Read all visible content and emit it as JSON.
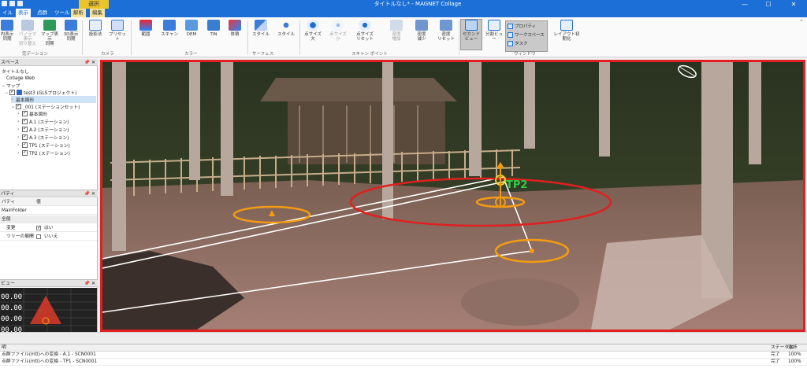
{
  "titlebar": {
    "context_tab": "選択",
    "title": "タイトルなし* - MAGNET Collage",
    "minimize": "—",
    "maximize": "☐",
    "close": "✕"
  },
  "tabs": [
    {
      "label": "イル"
    },
    {
      "label": "表示"
    },
    {
      "label": "点群"
    },
    {
      "label": "ツール"
    },
    {
      "label": "解析"
    },
    {
      "label": "編集"
    }
  ],
  "ribbon": {
    "buttons": [
      {
        "label": "内表示\n同期",
        "icon": "sync-view-icon"
      },
      {
        "label": "パノラマ表示\n切り替え",
        "icon": "panorama-icon"
      },
      {
        "label": "マップ表示\n同期",
        "icon": "map-sync-icon"
      },
      {
        "label": "3D表示\n同期",
        "icon": "3d-sync-icon"
      },
      {
        "label": "投影法",
        "icon": "projection-icon"
      },
      {
        "label": "プリセット",
        "icon": "preset-icon"
      },
      {
        "label": "範囲",
        "icon": "range-icon"
      },
      {
        "label": "スキャン",
        "icon": "scan-icon"
      },
      {
        "label": "DEM",
        "icon": "dem-icon"
      },
      {
        "label": "TIN",
        "icon": "tin-icon"
      },
      {
        "label": "体積",
        "icon": "volume-icon"
      },
      {
        "label": "スタイル",
        "icon": "surface-style-icon"
      },
      {
        "label": "スタイル",
        "icon": "point-style-icon"
      },
      {
        "label": "点サイズ\n大",
        "icon": "point-size-up-icon"
      },
      {
        "label": "点サイズ\n小",
        "icon": "point-size-down-icon"
      },
      {
        "label": "点サイズ\nリセット",
        "icon": "point-size-reset-icon"
      },
      {
        "label": "密度\n増加",
        "icon": "density-up-icon"
      },
      {
        "label": "密度\n減少",
        "icon": "density-down-icon"
      },
      {
        "label": "密度\nリセット",
        "icon": "density-reset-icon"
      },
      {
        "label": "セカンドビュー",
        "icon": "second-view-icon"
      },
      {
        "label": "分割ビュー",
        "icon": "split-view-icon"
      },
      {
        "label": "レイアウト初期化",
        "icon": "layout-reset-icon"
      }
    ],
    "groups": [
      "完デーション",
      "カメラ",
      "カラー",
      "サーフェス",
      "スキャン ポイント",
      "ウィンドウ"
    ],
    "window_checks": [
      "プロパティ",
      "ワークスペース",
      "タスク"
    ]
  },
  "workspace": {
    "header": "スペース",
    "nodes": [
      {
        "label": "タイトルなし",
        "indent": 0
      },
      {
        "label": "Collage Web",
        "indent": 0
      },
      {
        "label": "マップ",
        "indent": 0
      },
      {
        "label": "test3 (GLSプロジェクト)",
        "indent": 1
      },
      {
        "label": "基本図形",
        "indent": 2
      },
      {
        "label": "_001 (ステーションセット)",
        "indent": 2
      },
      {
        "label": "基本図形",
        "indent": 3
      },
      {
        "label": "A.1 (ステーション)",
        "indent": 3
      },
      {
        "label": "A.2 (ステーション)",
        "indent": 3
      },
      {
        "label": "A.3 (ステーション)",
        "indent": 3
      },
      {
        "label": "TP1 (ステーション)",
        "indent": 3
      },
      {
        "label": "TP2 (ステーション)",
        "indent": 3
      }
    ]
  },
  "properties": {
    "header": "パティ",
    "col_key": "パティ",
    "col_value": "値",
    "rows": [
      {
        "k": "MainFolder",
        "v": ""
      },
      {
        "k": "全般",
        "v": ""
      },
      {
        "k": "変更",
        "v": "はい",
        "checked": true
      },
      {
        "k": "ツリーの展開",
        "v": "いいえ",
        "checked": false
      }
    ]
  },
  "preview": {
    "header": "ビュー",
    "values": [
      "00.00",
      "00.00",
      "00.00",
      "00.00"
    ]
  },
  "viewport": {
    "station_label": "TP2"
  },
  "tasks": {
    "col_desc": "明",
    "col_status": "ステータス",
    "col_progress": "進捗",
    "rows": [
      {
        "desc": "点群ファイル(mtl)への変換 - A.1 - SCN0001",
        "status": "完了",
        "progress": "100%"
      },
      {
        "desc": "点群ファイル(mtl)への変換 - TP1 - SCN0001",
        "status": "完了",
        "progress": "100%"
      }
    ]
  },
  "colors": {
    "accent": "#1b6fd6",
    "viewport_border": "#e02020",
    "marker_orange": "#f39c12",
    "marker_red": "#e02020",
    "label_green": "#2ecc40"
  }
}
